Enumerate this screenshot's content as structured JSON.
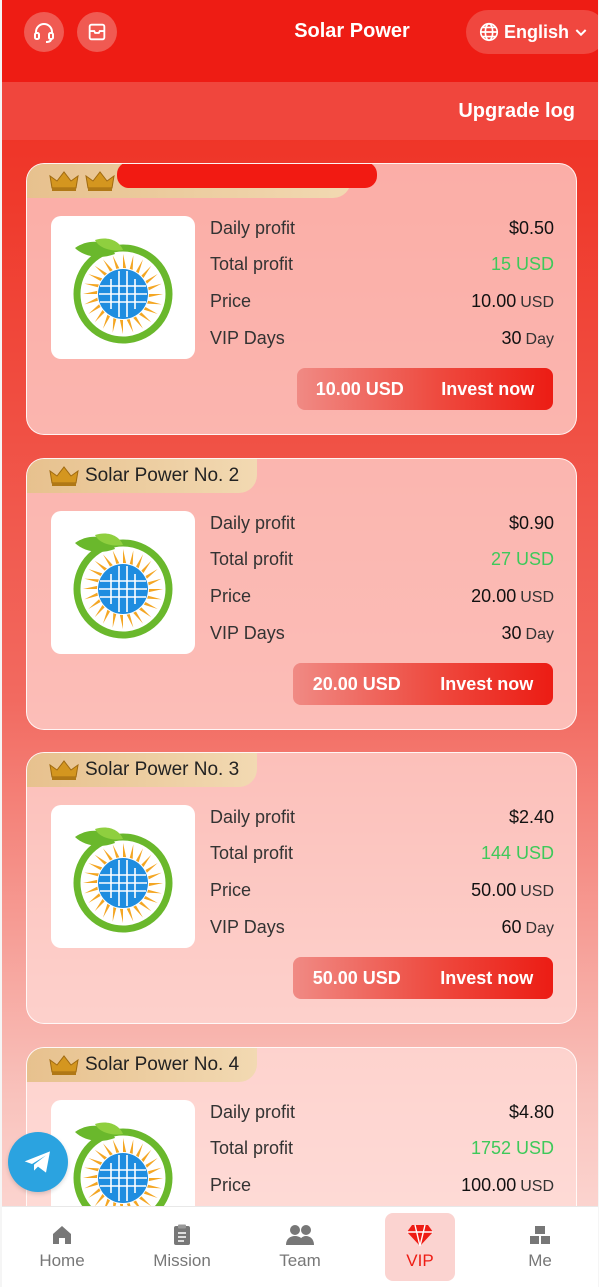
{
  "header": {
    "title": "Solar Power",
    "language": "English",
    "support_icon": "headset-icon",
    "inbox_icon": "inbox-icon",
    "upgrade_log": "Upgrade log"
  },
  "labels": {
    "daily_profit": "Daily profit",
    "total_profit": "Total profit",
    "price": "Price",
    "vip_days": "VIP Days",
    "invest_now": "Invest now",
    "usd_unit": "USD",
    "day_unit": "Day"
  },
  "cards": [
    {
      "name": "",
      "daily_profit": "$0.50",
      "total_profit": "15 USD",
      "price": "10.00",
      "vip_days": "30",
      "button_price": "10.00 USD"
    },
    {
      "name": "Solar Power No. 2",
      "daily_profit": "$0.90",
      "total_profit": "27 USD",
      "price": "20.00",
      "vip_days": "30",
      "button_price": "20.00 USD"
    },
    {
      "name": "Solar Power No. 3",
      "daily_profit": "$2.40",
      "total_profit": "144 USD",
      "price": "50.00",
      "vip_days": "60",
      "button_price": "50.00 USD"
    },
    {
      "name": "Solar Power No. 4",
      "daily_profit": "$4.80",
      "total_profit": "1752 USD",
      "price": "100.00",
      "vip_days": "",
      "button_price": ""
    }
  ],
  "nav": [
    {
      "label": "Home",
      "icon": "home-icon"
    },
    {
      "label": "Mission",
      "icon": "clipboard-icon"
    },
    {
      "label": "Team",
      "icon": "team-icon"
    },
    {
      "label": "VIP",
      "icon": "diamond-icon"
    },
    {
      "label": "Me",
      "icon": "blocks-icon"
    }
  ],
  "colors": {
    "brand_red": "#ee1c14",
    "profit_green": "#3ec95a",
    "telegram_blue": "#2ba3e0"
  }
}
